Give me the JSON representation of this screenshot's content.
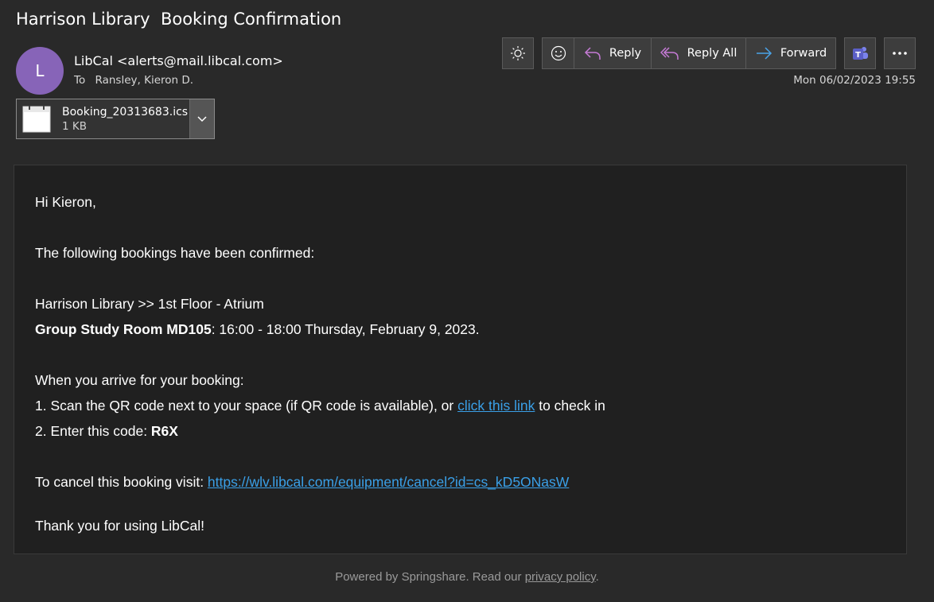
{
  "subject": "Harrison Library  Booking Confirmation",
  "sender": {
    "initial": "L",
    "name": "LibCal <alerts@mail.libcal.com>",
    "avatar_color": "#8764b8"
  },
  "recipients": {
    "to_label": "To",
    "to": "Ransley, Kieron D."
  },
  "date": "Mon 06/02/2023 19:55",
  "attachment": {
    "name": "Booking_20313683.ics",
    "size": "1 KB"
  },
  "toolbar": {
    "reply_label": "Reply",
    "reply_all_label": "Reply All",
    "forward_label": "Forward",
    "reply_color": "#c67bd6",
    "forward_color": "#4aa3e8",
    "teams_color": "#5b5fc7"
  },
  "body": {
    "greeting": "Hi Kieron,",
    "intro": "The following bookings have been confirmed:",
    "location": "Harrison Library >> 1st Floor - Atrium",
    "room": "Group Study Room MD105",
    "time": ": 16:00 - 18:00 Thursday, February 9, 2023.",
    "arrive_heading": "When you arrive for your booking:",
    "step1_prefix": "1. Scan the QR code next to your space (if QR code is available), or ",
    "step1_link": "click this link",
    "step1_suffix": " to check in",
    "step2_prefix": "2. Enter this code: ",
    "step2_code": "R6X",
    "cancel_prefix": "To cancel this booking visit: ",
    "cancel_link": "https://wlv.libcal.com/equipment/cancel?id=cs_kD5ONasW",
    "thanks": "Thank you for using LibCal!"
  },
  "footer": {
    "text": "Powered by Springshare. Read our ",
    "link": "privacy policy",
    "end": "."
  }
}
